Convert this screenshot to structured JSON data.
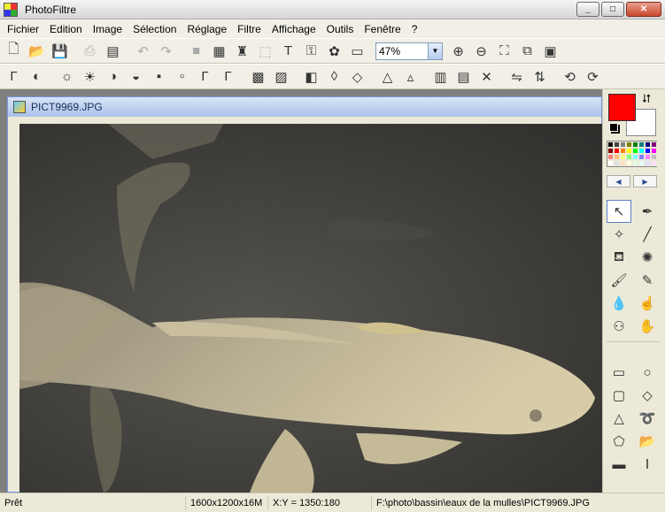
{
  "window": {
    "title": "PhotoFiltre"
  },
  "menu": [
    "Fichier",
    "Edition",
    "Image",
    "Sélection",
    "Réglage",
    "Filtre",
    "Affichage",
    "Outils",
    "Fenêtre",
    "?"
  ],
  "toolbar1": {
    "zoom": "47%"
  },
  "document": {
    "title": "PICT9969.JPG"
  },
  "colors": {
    "foreground": "#ff0000",
    "background": "#ffffff"
  },
  "palette": [
    "#000000",
    "#404040",
    "#808080",
    "#808000",
    "#008000",
    "#008080",
    "#000080",
    "#800080",
    "#800000",
    "#ff0000",
    "#ff8000",
    "#ffff00",
    "#00ff00",
    "#00ffff",
    "#0000ff",
    "#ff00ff",
    "#ff8080",
    "#ffc080",
    "#ffff80",
    "#80ff80",
    "#80ffff",
    "#8080ff",
    "#ff80ff",
    "#c0c0c0",
    "#ffffff",
    "#e0e0e0",
    "#ffe0c0",
    "#ffffe0",
    "#e0ffe0",
    "#e0ffff",
    "#e0e0ff",
    "#ffe0ff"
  ],
  "status": {
    "state": "Prêt",
    "dimensions": "1600x1200x16M",
    "coords": "X:Y = 1350:180",
    "path": "F:\\photo\\bassin\\eaux de la mulles\\PICT9969.JPG"
  }
}
